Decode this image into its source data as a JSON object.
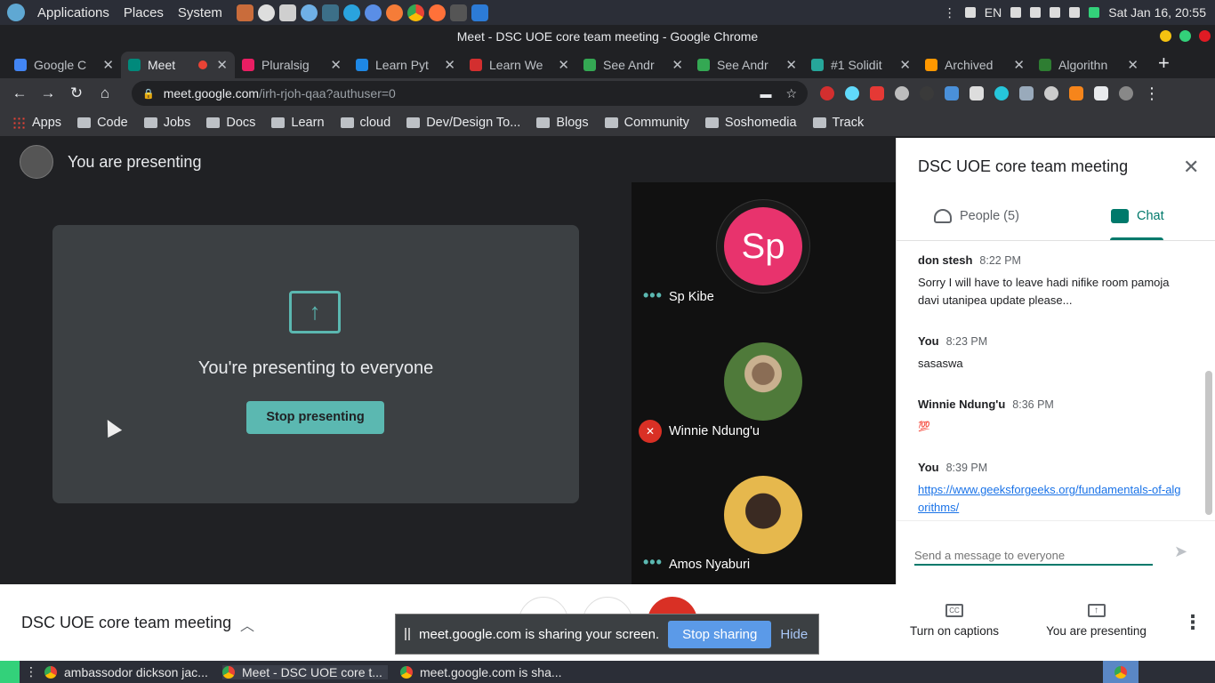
{
  "os_panel": {
    "menus": [
      "Applications",
      "Places",
      "System"
    ],
    "lang": "EN",
    "clock": "Sat Jan 16, 20:55"
  },
  "window": {
    "title": "Meet - DSC UOE core team meeting - Google Chrome"
  },
  "tabs": [
    {
      "label": "Google C",
      "color": "#4285f4"
    },
    {
      "label": "Meet",
      "color": "#00897b",
      "active": true
    },
    {
      "label": "Pluralsig",
      "color": "#e91e63"
    },
    {
      "label": "Learn Pyt",
      "color": "#1e88e5"
    },
    {
      "label": "Learn We",
      "color": "#d32f2f"
    },
    {
      "label": "See Andr",
      "color": "#34a853"
    },
    {
      "label": "See Andr",
      "color": "#34a853"
    },
    {
      "label": "#1 Solidit",
      "color": "#26a69a"
    },
    {
      "label": "Archived",
      "color": "#ff9800"
    },
    {
      "label": "Algorithn",
      "color": "#2e7d32"
    }
  ],
  "address": {
    "host": "meet.google.com",
    "path": "/irh-rjoh-qaa?authuser=0"
  },
  "bookmarks": [
    "Apps",
    "Code",
    "Jobs",
    "Docs",
    "Learn",
    "cloud",
    "Dev/Design To...",
    "Blogs",
    "Community",
    "Soshomedia",
    "Track"
  ],
  "meet": {
    "presenting_label": "You are presenting",
    "present_message": "You're presenting to everyone",
    "stop_presenting": "Stop presenting",
    "participants": [
      {
        "name": "Sp Kibe",
        "initials": "Sp",
        "color": "#e8336d",
        "status": "speaking-dots"
      },
      {
        "name": "Winnie Ndung'u",
        "color": "#6b8f4e",
        "status": "muted"
      },
      {
        "name": "Amos Nyaburi",
        "color": "#e6b84d",
        "status": "speaking-dots"
      }
    ]
  },
  "panel": {
    "title": "DSC UOE core team meeting",
    "tab_people": "People (5)",
    "tab_chat": "Chat",
    "messages": [
      {
        "sender": "don stesh",
        "time": "8:22 PM",
        "text": "Sorry I will  have to leave hadi nifike room pamoja davi utanipea update please..."
      },
      {
        "sender": "You",
        "time": "8:23 PM",
        "text": "sasaswa"
      },
      {
        "sender": "Winnie Ndung'u",
        "time": "8:36 PM",
        "text": "💯"
      },
      {
        "sender": "You",
        "time": "8:39 PM",
        "text": "https://www.geeksforgeeks.org/fundamentals-of-algorithms/",
        "is_link": true
      }
    ],
    "input_placeholder": "Send a message to everyone"
  },
  "bottom": {
    "meeting_name": "DSC UOE core team meeting",
    "captions": "Turn on captions",
    "captions_icon_text": "CC",
    "you_presenting": "You are presenting"
  },
  "share_banner": {
    "text": "meet.google.com is sharing your screen.",
    "stop": "Stop sharing",
    "hide": "Hide"
  },
  "taskbar": {
    "items": [
      "ambassodor dickson jac...",
      "Meet - DSC UOE core t...",
      "meet.google.com is sha..."
    ]
  }
}
